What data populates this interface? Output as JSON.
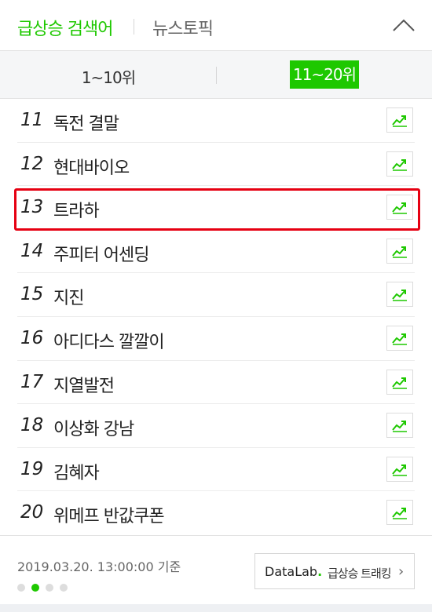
{
  "header": {
    "tab_active": "급상승 검색어",
    "tab_inactive": "뉴스토픽"
  },
  "subtabs": {
    "range1": "1~10위",
    "range2": "11~20위"
  },
  "keywords": [
    {
      "rank": "11",
      "keyword": "독전 결말"
    },
    {
      "rank": "12",
      "keyword": "현대바이오"
    },
    {
      "rank": "13",
      "keyword": "트라하"
    },
    {
      "rank": "14",
      "keyword": "주피터 어센딩"
    },
    {
      "rank": "15",
      "keyword": "지진"
    },
    {
      "rank": "16",
      "keyword": "아디다스 깔깔이"
    },
    {
      "rank": "17",
      "keyword": "지열발전"
    },
    {
      "rank": "18",
      "keyword": "이상화 강남"
    },
    {
      "rank": "19",
      "keyword": "김혜자"
    },
    {
      "rank": "20",
      "keyword": "위메프 반값쿠폰"
    }
  ],
  "footer": {
    "timestamp": "2019.03.20. 13:00:00 기준",
    "datalab_brand": "DataLab.",
    "datalab_label": "급상승 트래킹",
    "pager_total": 4,
    "pager_active": 2
  },
  "colors": {
    "accent": "#1ec800",
    "highlight_border": "#e60012"
  },
  "icons": {
    "collapse": "chevron-up-icon",
    "trend": "trend-chart-icon",
    "datalab_arrow": "chevron-right-icon"
  }
}
